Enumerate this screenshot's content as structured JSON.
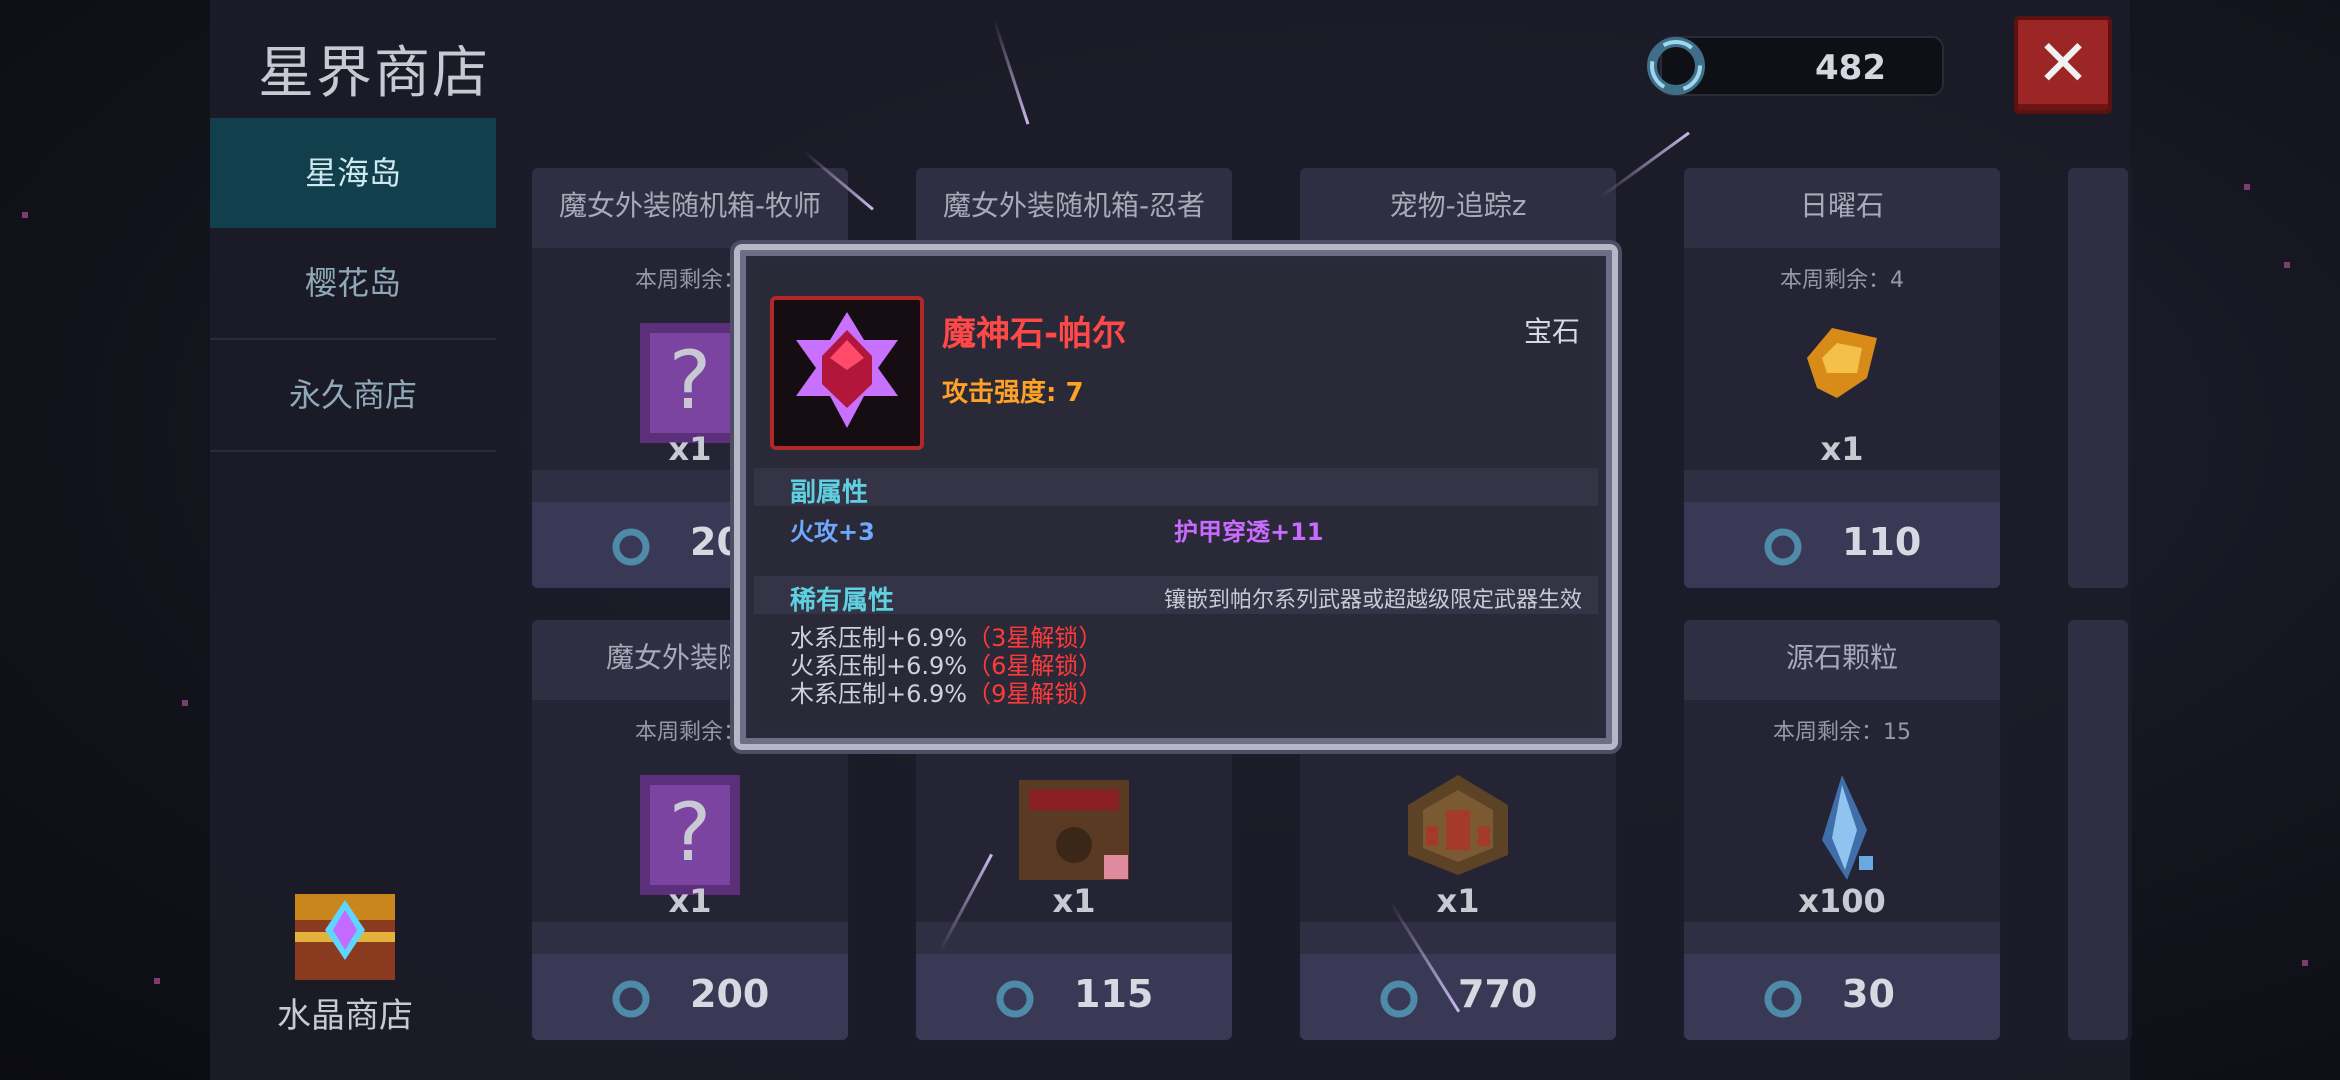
{
  "shop_title": "星界商店",
  "currency": {
    "amount": "482",
    "icon": "crystal-coin-icon"
  },
  "close_label": "✕",
  "sidebar": {
    "items": [
      {
        "label": "星海岛",
        "active": true
      },
      {
        "label": "樱花岛",
        "active": false
      },
      {
        "label": "永久商店",
        "active": false
      }
    ],
    "crystal_shop_label": "水晶商店"
  },
  "cards": [
    {
      "name": "魔女外装随机箱-牧师",
      "remain": "本周剩余：",
      "qty": "x1",
      "price": "20"
    },
    {
      "name": "魔女外装随机箱-忍者",
      "remain": "",
      "qty": "",
      "price": ""
    },
    {
      "name": "宠物-追踪z",
      "remain": "",
      "qty": "",
      "price": ""
    },
    {
      "name": "日曜石",
      "remain": "本周剩余：4",
      "qty": "x1",
      "price": "110"
    },
    {
      "name": "魔女外装随机",
      "remain": "本周剩余：",
      "qty": "x1",
      "price": "200"
    },
    {
      "name": "",
      "remain": "",
      "qty": "x1",
      "price": "115"
    },
    {
      "name": "",
      "remain": "",
      "qty": "x1",
      "price": "770"
    },
    {
      "name": "源石颗粒",
      "remain": "本周剩余：15",
      "qty": "x100",
      "price": "30"
    }
  ],
  "popup": {
    "name": "魔神石-帕尔",
    "type": "宝石",
    "attack": "攻击强度: 7",
    "sub_title": "副属性",
    "sub_attrs": [
      "火攻+3",
      "护甲穿透+11"
    ],
    "rare_title": "稀有属性",
    "rare_note": "镶嵌到帕尔系列武器或超越级限定武器生效",
    "rare_attrs": [
      {
        "text": "水系压制+6.9%",
        "lock": "（3星解锁）"
      },
      {
        "text": "火系压制+6.9%",
        "lock": "（6星解锁）"
      },
      {
        "text": "木系压制+6.9%",
        "lock": "（9星解锁）"
      }
    ]
  },
  "colors": {
    "accent_red": "#ff4848",
    "sub_attr_blue": "#6fa8ff",
    "sub_attr_purple": "#c96bff",
    "lock_red": "#ff3a3a",
    "active_tab": "#11404c"
  }
}
